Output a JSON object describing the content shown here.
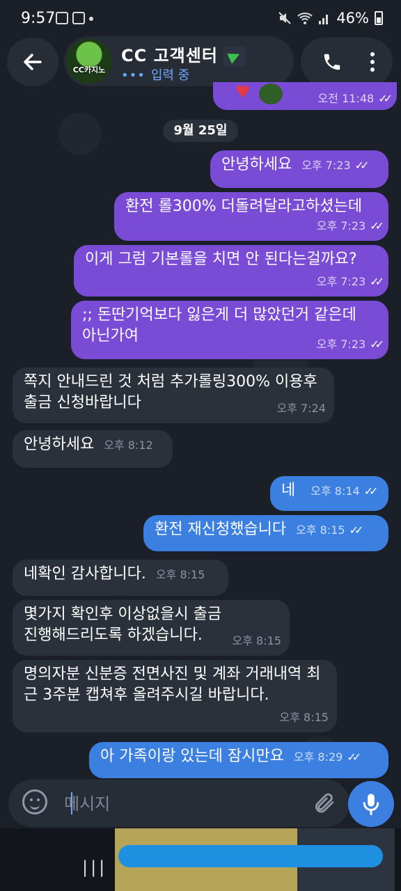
{
  "status_bar": {
    "time": "9:57",
    "battery": "46%"
  },
  "header": {
    "title": "CC 고객센터",
    "status": "입력 중",
    "typing_dots": "•••",
    "avatar_label": "CC카지노"
  },
  "prev_message": {
    "time": "오전 11:48",
    "ticks": "✓✓"
  },
  "date_separator": "9월 25일",
  "messages": [
    {
      "text": "안녕하세요",
      "time": "오후 7:23",
      "ticks": "✓✓"
    },
    {
      "text": "환전 롤300% 더돌려달라고하셨는데",
      "time": "오후 7:23",
      "ticks": "✓✓"
    },
    {
      "text": "이게 그럼 기본롤을 치면 안 된다는걸까요?",
      "time": "오후 7:23",
      "ticks": "✓✓"
    },
    {
      "text": ";; 돈딴기억보다 잃은게 더 많았던거 같은데 아닌가여",
      "time": "오후 7:23",
      "ticks": "✓✓"
    },
    {
      "text": "쪽지 안내드린 것 처럼 추가롤링300% 이용후 출금 신청바랍니다",
      "time": "오후 7:24"
    },
    {
      "text": "안녕하세요",
      "time": "오후 8:12"
    },
    {
      "text": "네",
      "time": "오후 8:14",
      "ticks": "✓✓"
    },
    {
      "text": "환전 재신청했습니다",
      "time": "오후 8:15",
      "ticks": "✓✓"
    },
    {
      "text": "네확인 감사합니다.",
      "time": "오후 8:15"
    },
    {
      "text": "몇가지 확인후 이상없을시 출금 진행해드리도록 하겠습니다.",
      "time": "오후 8:15"
    },
    {
      "text": "명의자분 신분증 전면사진 및 계좌 거래내역 최근 3주분 캡쳐후 올려주시길 바랍니다.",
      "time": "오후 8:15"
    },
    {
      "text": "아 가족이랑 있는데 잠시만요",
      "time": "오후 8:29",
      "ticks": "✓✓"
    }
  ],
  "composer": {
    "placeholder": "메시지"
  },
  "nav": {
    "recents": "|||"
  },
  "colors": {
    "outgoing_purple": "#7a4cd6",
    "outgoing_blue": "#3b7fe0",
    "incoming": "#2a313b",
    "background": "#1b2028"
  }
}
